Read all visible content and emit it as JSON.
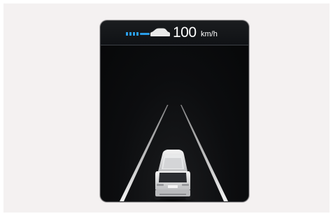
{
  "display": {
    "set_speed": "100",
    "speed_unit": "km/h",
    "distance_setting_bars": 4,
    "colors": {
      "accent": "#2a9de8",
      "background": "#070809",
      "lane": "#e6e6e6"
    },
    "icons": {
      "distance": "time-gap-bars-icon",
      "vehicle_ahead": "car-ahead-icon",
      "own_vehicle": "own-vehicle-icon"
    }
  }
}
